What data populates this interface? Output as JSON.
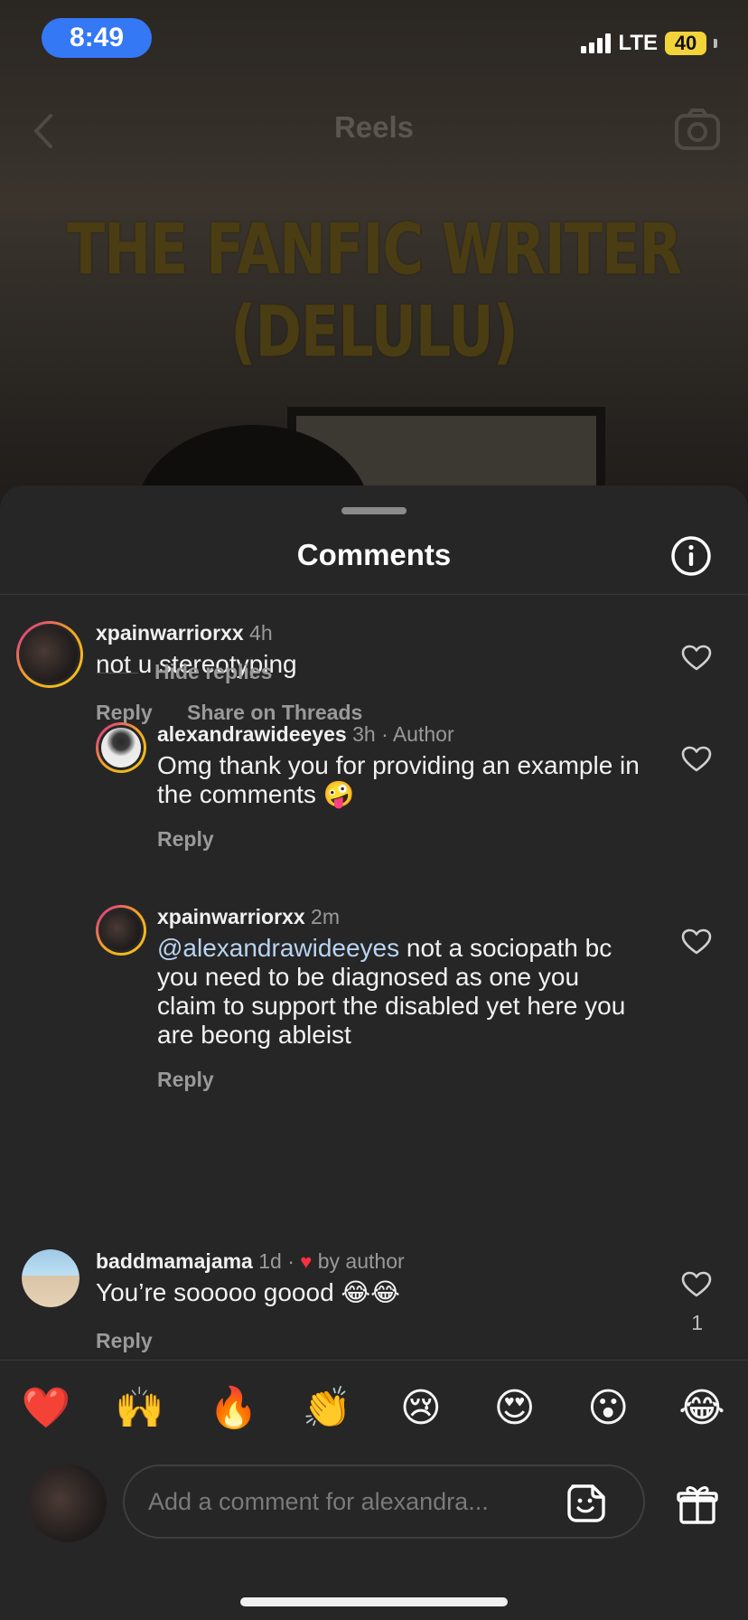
{
  "status_bar": {
    "time": "8:49",
    "network": "LTE",
    "battery": "40"
  },
  "reel": {
    "title": "Reels",
    "caption_overlay": "THE FANFIC WRITER (DELULU)"
  },
  "comments_sheet": {
    "title": "Comments",
    "hide_replies_label": "Hide replies",
    "comments": [
      {
        "username": "xpainwarriorxx",
        "time": "4h",
        "text": "not u stereotyping",
        "reply_label": "Reply",
        "share_label": "Share on Threads"
      },
      {
        "username": "alexandrawideeyes",
        "time": "3h",
        "author_tag": "· Author",
        "text": "Omg thank you for providing an example in the comments 🤪",
        "reply_label": "Reply"
      },
      {
        "username": "xpainwarriorxx",
        "time": "2m",
        "mention": "@alexandrawideeyes",
        "text": " not a sociopath bc you need to be diagnosed as one you claim to support the disabled yet here you are beong ableist",
        "reply_label": "Reply"
      },
      {
        "username": "baddmamajama",
        "time": "1d",
        "liked_by": "by author",
        "text": "You’re sooooo goood 😂😂",
        "reply_label": "Reply",
        "likes": "1"
      }
    ]
  },
  "emoji_bar": [
    "❤️",
    "🙌",
    "🔥",
    "👏",
    "😢",
    "😍",
    "😮",
    "😂"
  ],
  "comment_input": {
    "placeholder": "Add a comment for alexandra..."
  },
  "icons": {
    "back": "chevron-left-icon",
    "camera": "camera-icon",
    "info": "info-icon",
    "like": "heart-outline-icon",
    "sticker": "sticker-icon",
    "gift": "gift-icon"
  },
  "colors": {
    "accent_blue": "#3478f6",
    "battery_yellow": "#f2d33a",
    "like_red": "#ff3040"
  }
}
